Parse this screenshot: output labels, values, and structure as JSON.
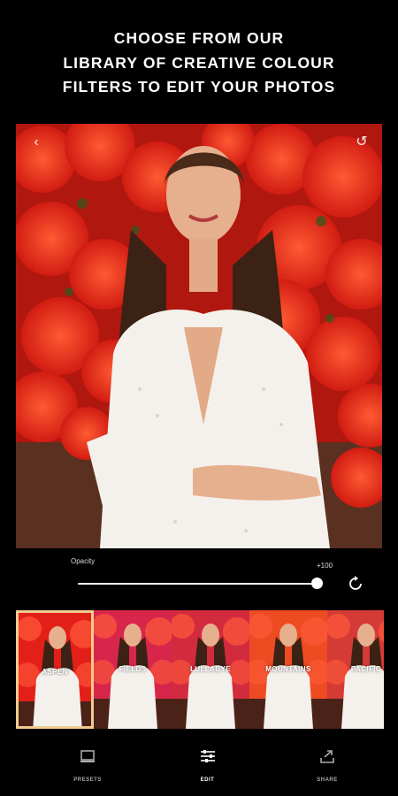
{
  "headline": {
    "line1": "CHOOSE FROM OUR",
    "line2": "LIBRARY OF CREATIVE COLOUR",
    "line3": "FILTERS TO EDIT YOUR PHOTOS"
  },
  "editor": {
    "opacity_label": "Opacity",
    "opacity_value_text": "+100",
    "opacity_level": 1.0
  },
  "filters": [
    {
      "name": "ASPEN",
      "selected": true,
      "tint": "#e31f19"
    },
    {
      "name": "FIELDS",
      "selected": false,
      "tint": "#d8264b"
    },
    {
      "name": "LULLABYE",
      "selected": false,
      "tint": "#d32b3e"
    },
    {
      "name": "MOUNTAINS",
      "selected": false,
      "tint": "#ee4b22"
    },
    {
      "name": "PACIFIC",
      "selected": false,
      "tint": "#d53b36"
    }
  ],
  "nav": {
    "presets": "PRESETS",
    "edit": "EDIT",
    "share": "SHARE"
  },
  "colors": {
    "accent": "#f1cc8e",
    "background": "#000000",
    "flowers": "#e62b18"
  }
}
